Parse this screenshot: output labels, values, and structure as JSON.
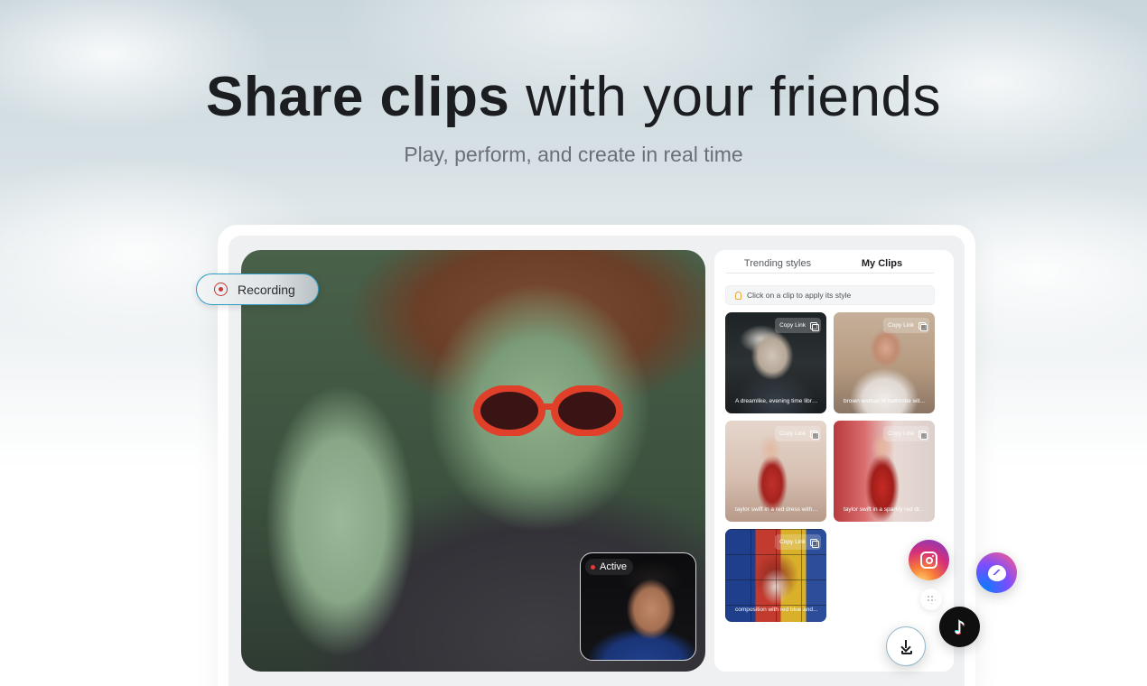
{
  "hero": {
    "title_bold": "Share clips",
    "title_light": " with your friends",
    "subtitle": "Play, perform, and create in real time"
  },
  "recording": {
    "label": "Recording",
    "icon": "record-icon"
  },
  "video": {
    "camera_status": "Active"
  },
  "panel": {
    "tabs": [
      {
        "label": "Trending styles",
        "selected": false
      },
      {
        "label": "My Clips",
        "selected": true
      }
    ],
    "hint": "Click on a clip to apply its style",
    "clips": [
      {
        "caption": "A dreamlike, evening time libra...",
        "copy_label": "Copy Link"
      },
      {
        "caption": "brown woman in bathrobe wit...",
        "copy_label": "Copy Link"
      },
      {
        "caption": "taylor swift in a red dress with ...",
        "copy_label": "Copy Link"
      },
      {
        "caption": "taylor swift in a sparkly red dr...",
        "copy_label": "Copy Link"
      },
      {
        "caption": "composition with red blue and...",
        "copy_label": "Copy Link"
      }
    ]
  },
  "share": {
    "buttons": [
      "instagram-icon",
      "messenger-icon",
      "tiktok-icon",
      "more-dots-icon",
      "download-icon"
    ]
  }
}
